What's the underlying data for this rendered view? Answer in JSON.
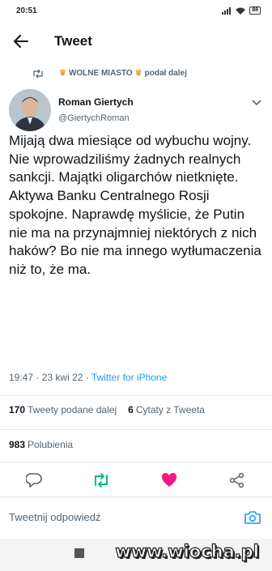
{
  "status_bar": {
    "time": "20:51",
    "battery": "88"
  },
  "header": {
    "title": "Tweet"
  },
  "retweet": {
    "account": "WOLNE MIASTO",
    "action": "podał dalej"
  },
  "author": {
    "name": "Roman Giertych",
    "handle": "@GiertychRoman"
  },
  "tweet": {
    "text": "Mijają dwa miesiące od wybuchu wojny.\nNie wprowadziliśmy żadnych realnych sankcji. Majątki oligarchów nietknięte. Aktywa Banku Centralnego Rosji spokojne. Naprawdę myślicie, że Putin nie ma na przynajmniej niektórych z nich haków? Bo nie ma innego wytłumaczenia niż to, że ma.",
    "time": "19:47",
    "date": "23 kwi 22",
    "source": "Twitter for iPhone"
  },
  "stats": {
    "retweets_count": "170",
    "retweets_label": "Tweety podane dalej",
    "quotes_count": "6",
    "quotes_label": "Cytaty z Tweeta",
    "likes_count": "983",
    "likes_label": "Polubienia"
  },
  "reply": {
    "placeholder": "Tweetnij odpowiedź"
  },
  "watermark": "www.wiocha.pl",
  "colors": {
    "accent": "#1d9bf0",
    "retweet": "#00ba7c",
    "like": "#f91880",
    "crown": "#e8a23a"
  },
  "icons": {
    "back": "arrow-left-icon",
    "retweet_indicator": "retweet-icon",
    "more": "chevron-down-icon",
    "reply": "reply-icon",
    "retweet": "retweet-icon",
    "like": "heart-icon",
    "share": "share-icon",
    "camera": "camera-icon"
  }
}
